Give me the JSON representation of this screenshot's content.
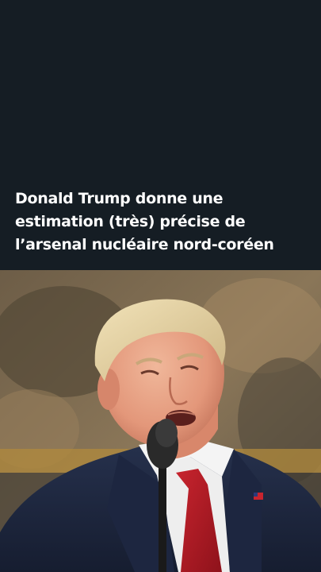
{
  "article": {
    "headline": "Donald Trump donne une estimation (très) précise de l’arsenal nucléaire nord-coréen"
  },
  "photo": {
    "subject": "person-speaking-at-microphone"
  },
  "colors": {
    "background": "#151d24",
    "headline_text": "#ffffff"
  }
}
